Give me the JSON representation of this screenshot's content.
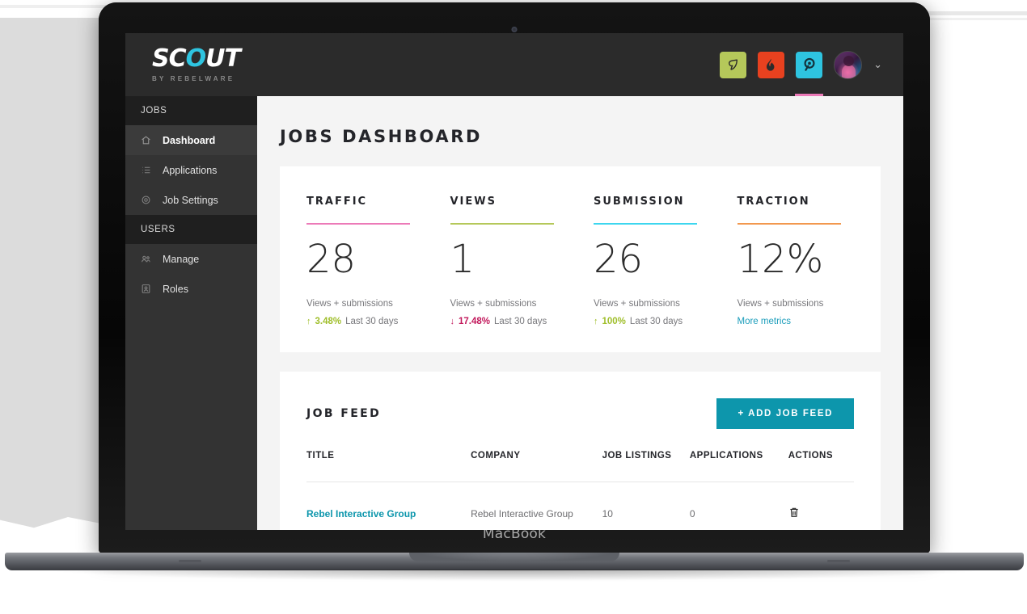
{
  "device": {
    "label": "MacBook"
  },
  "brand": {
    "logo_text": "SCOUT",
    "logo_prefix": "SC",
    "logo_mark": "O",
    "logo_suffix": "UT",
    "tagline": "BY REBELWARE"
  },
  "topbar": {
    "apps": [
      {
        "name": "leaf-app-icon",
        "glyph": "❦",
        "color": "#b5c85a",
        "active": false
      },
      {
        "name": "flame-app-icon",
        "glyph": "♨",
        "color": "#e8411f",
        "active": false
      },
      {
        "name": "scout-app-icon",
        "glyph": "Θ",
        "color": "#2ec4e0",
        "active": true
      }
    ],
    "active_indicator_color": "#ec7ab8",
    "chevron": "⌄"
  },
  "sidebar": {
    "groups": [
      {
        "title": "JOBS",
        "items": [
          {
            "label": "Dashboard",
            "icon": "home-icon",
            "active": true
          },
          {
            "label": "Applications",
            "icon": "list-icon",
            "active": false
          },
          {
            "label": "Job Settings",
            "icon": "gear-icon",
            "active": false
          }
        ]
      },
      {
        "title": "USERS",
        "items": [
          {
            "label": "Manage",
            "icon": "people-icon",
            "active": false
          },
          {
            "label": "Roles",
            "icon": "badge-icon",
            "active": false
          }
        ]
      }
    ]
  },
  "page": {
    "title": "JOBS DASHBOARD"
  },
  "metrics": [
    {
      "label": "TRAFFIC",
      "value": "28",
      "sub": "Views + submissions",
      "arrow": "↑",
      "delta": "3.48%",
      "delta_direction": "up",
      "period": "Last 30 days",
      "rule_color": "#ec7ab8"
    },
    {
      "label": "VIEWS",
      "value": "1",
      "sub": "Views + submissions",
      "arrow": "↓",
      "delta": "17.48%",
      "delta_direction": "down",
      "period": "Last 30 days",
      "rule_color": "#b5c85a"
    },
    {
      "label": "SUBMISSION",
      "value": "26",
      "sub": "Views + submissions",
      "arrow": "↑",
      "delta": "100%",
      "delta_direction": "up",
      "period": "Last 30 days",
      "rule_color": "#3dd6ef"
    },
    {
      "label": "TRACTION",
      "value": "12%",
      "sub": "Views + submissions",
      "link": "More metrics",
      "rule_color": "#f2984e"
    }
  ],
  "job_feed": {
    "title": "JOB FEED",
    "add_button": "+  ADD JOB FEED",
    "columns": [
      "TITLE",
      "COMPANY",
      "JOB LISTINGS",
      "APPLICATIONS",
      "ACTIONS"
    ],
    "rows": [
      {
        "title": "Rebel Interactive Group",
        "company": "Rebel Interactive Group",
        "job_listings": "10",
        "applications": "0",
        "action_icon": "trash-icon"
      }
    ]
  }
}
